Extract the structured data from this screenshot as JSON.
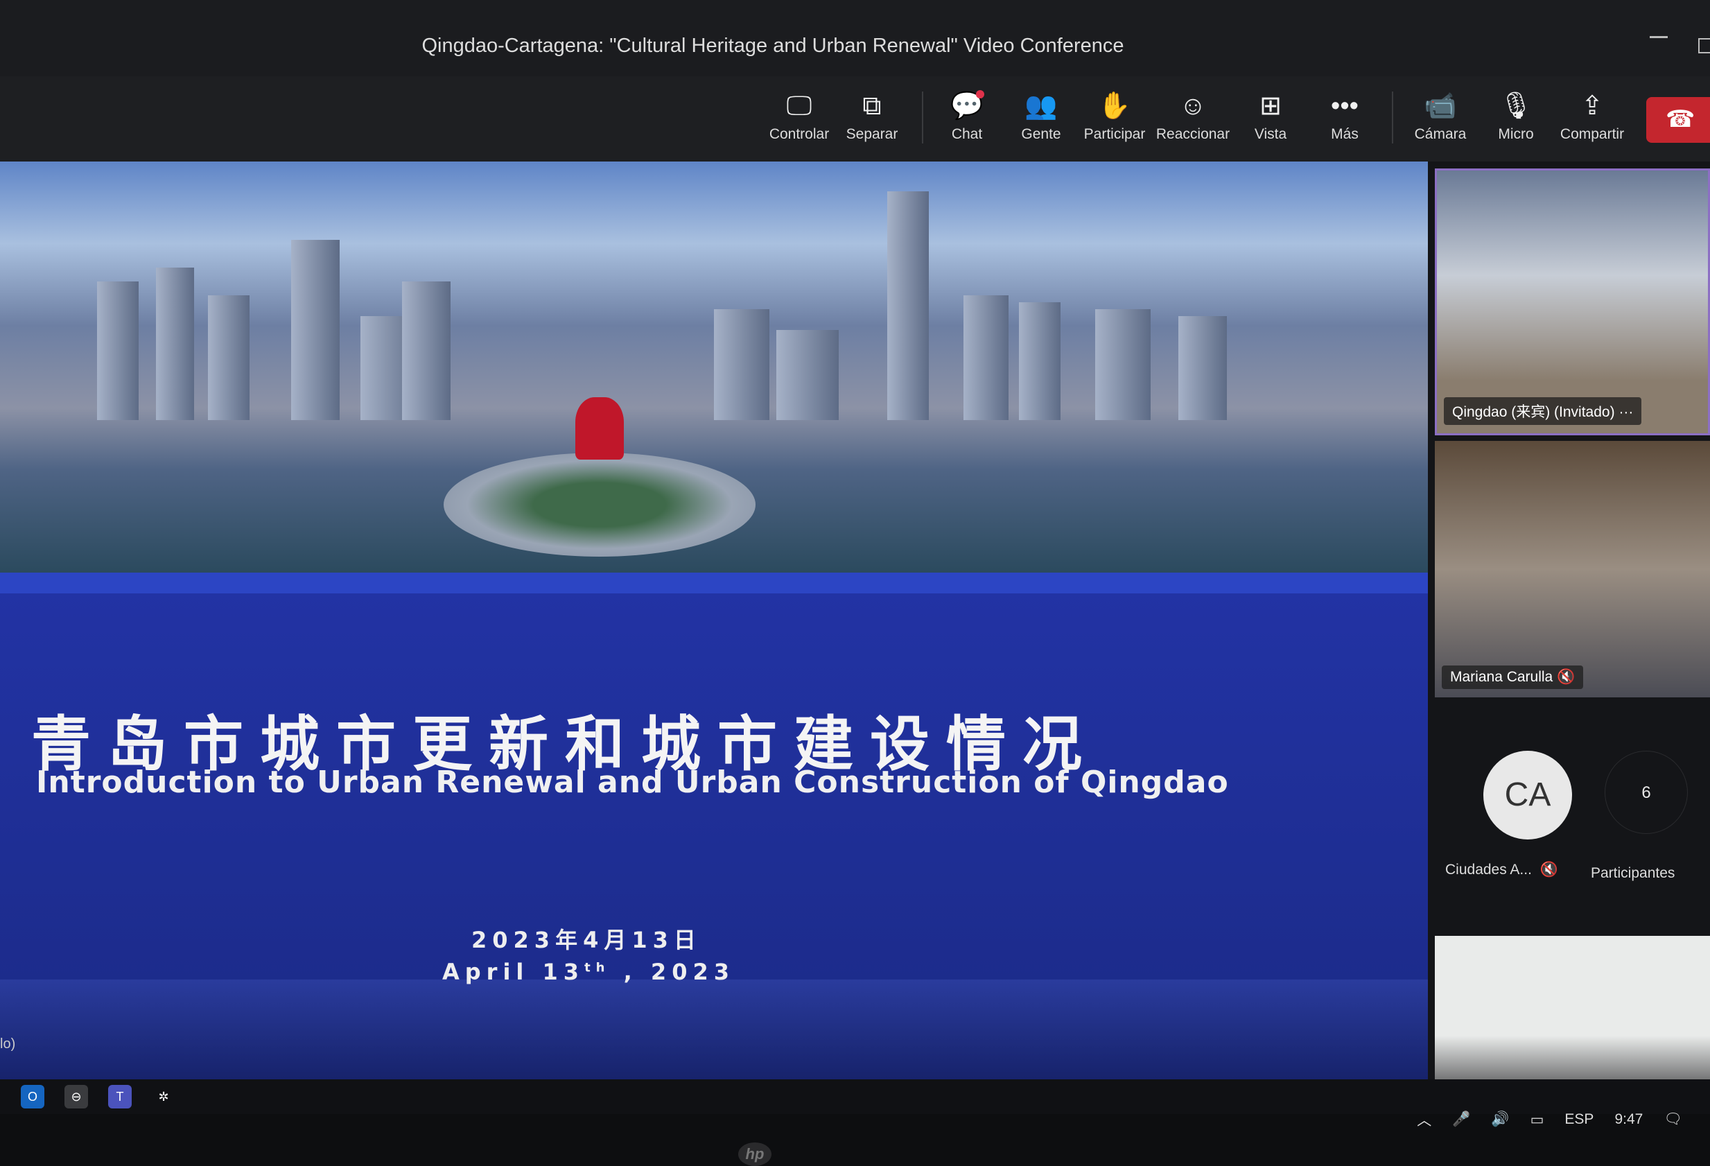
{
  "window": {
    "title": "Qingdao-Cartagena: \"Cultural Heritage and Urban Renewal\" Video Conference"
  },
  "toolbar": {
    "items": [
      {
        "label": "Controlar",
        "icon": "control-icon"
      },
      {
        "label": "Separar",
        "icon": "pop-out-icon"
      },
      {
        "label": "Chat",
        "icon": "chat-icon"
      },
      {
        "label": "Gente",
        "icon": "people-icon"
      },
      {
        "label": "Participar",
        "icon": "raise-hand-icon"
      },
      {
        "label": "Reaccionar",
        "icon": "react-icon"
      },
      {
        "label": "Vista",
        "icon": "view-icon"
      },
      {
        "label": "Más",
        "icon": "more-icon"
      },
      {
        "label": "Cámara",
        "icon": "camera-icon"
      },
      {
        "label": "Micro",
        "icon": "mic-off-icon"
      },
      {
        "label": "Compartir",
        "icon": "share-icon"
      }
    ],
    "hangup_color": "#c4262e",
    "chat_badge_color": "#e0324b"
  },
  "slide": {
    "title_zh": "青岛市城市更新和城市建设情况",
    "title_en": "Introduction to Urban Renewal and Urban Construction of Qingdao",
    "date_zh": "2023年4月13日",
    "date_en_prefix": "April 13",
    "date_en_sup": "th",
    "date_en_suffix": " , 2023"
  },
  "participants": {
    "tiles": [
      {
        "name": "Qingdao (来宾) (Invitado)",
        "more": "···"
      },
      {
        "name": "Mariana Carulla",
        "muted": true
      },
      {
        "initials": "CA",
        "name": "Ciudades A...",
        "muted": true
      }
    ],
    "count": "6",
    "count_label": "Participantes"
  },
  "taskbar": {
    "side_label": "lo)",
    "tray": {
      "language": "ESP",
      "time": "9:47"
    }
  }
}
